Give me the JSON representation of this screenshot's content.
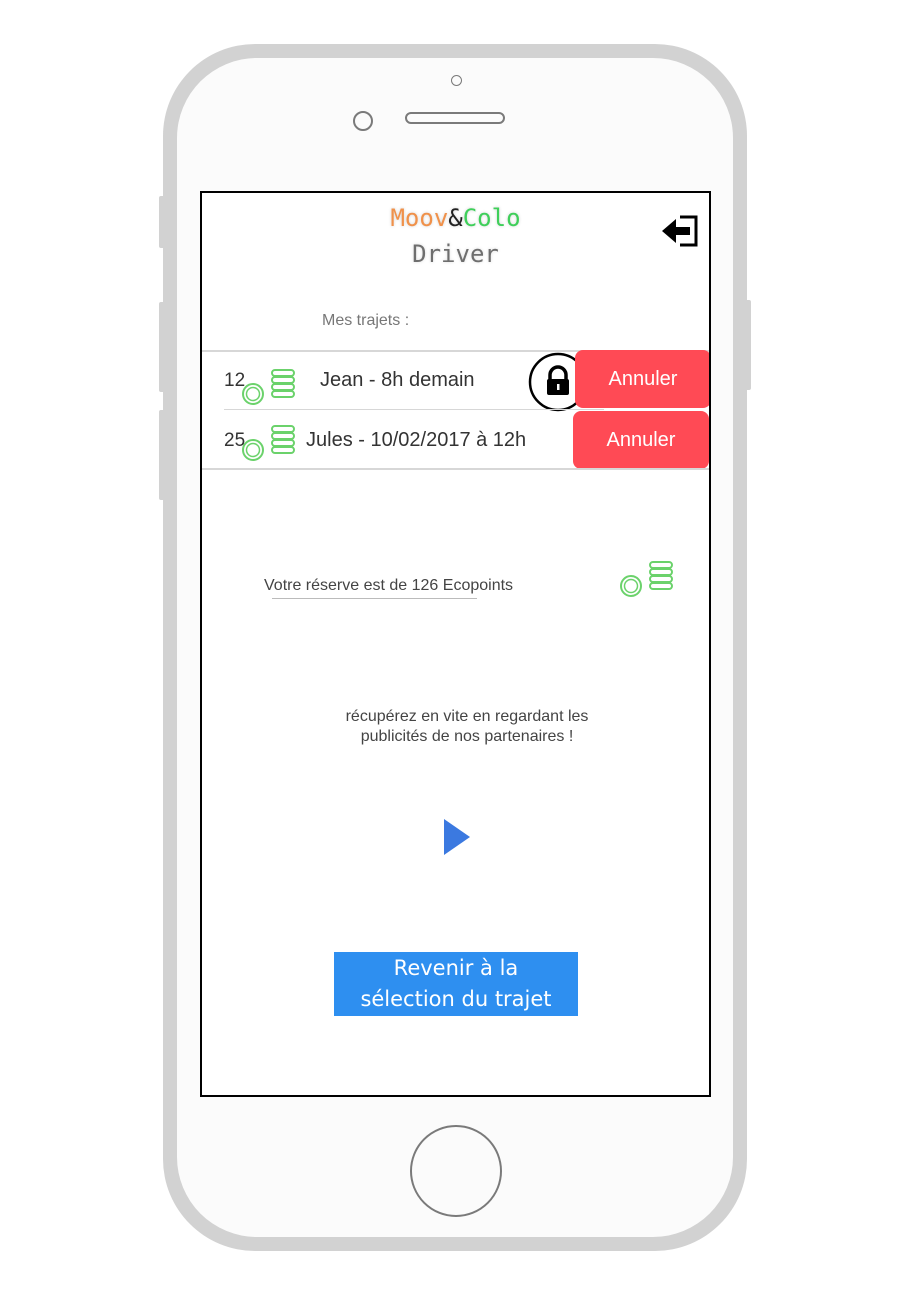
{
  "brand": {
    "part1": "Moov",
    "amp": "&",
    "part2": "Colo",
    "subtitle": "Driver"
  },
  "trips": {
    "heading": "Mes trajets :",
    "items": [
      {
        "count": "12",
        "label": "Jean - 8h demain",
        "locked": true,
        "cancel_label": "Annuler"
      },
      {
        "count": "25",
        "label": "Jules - 10/02/2017 à 12h",
        "locked": false,
        "cancel_label": "Annuler"
      }
    ]
  },
  "reserve": {
    "text": "Votre réserve est de 126 Ecopoints"
  },
  "promo": {
    "line1": "récupérez en vite en regardant les",
    "line2": "publicités de nos partenaires  !"
  },
  "back_button": {
    "line1": "Revenir à la",
    "line2": "sélection du trajet"
  },
  "icons": {
    "logout": "logout-icon",
    "lock": "lock-icon",
    "coins": "coins-icon",
    "play": "play-icon"
  },
  "colors": {
    "cancel": "#ff4a55",
    "primary": "#2e8ff0",
    "coins": "#6bd26b",
    "brand_orange": "#f0914a",
    "brand_green": "#3fcf5a"
  }
}
